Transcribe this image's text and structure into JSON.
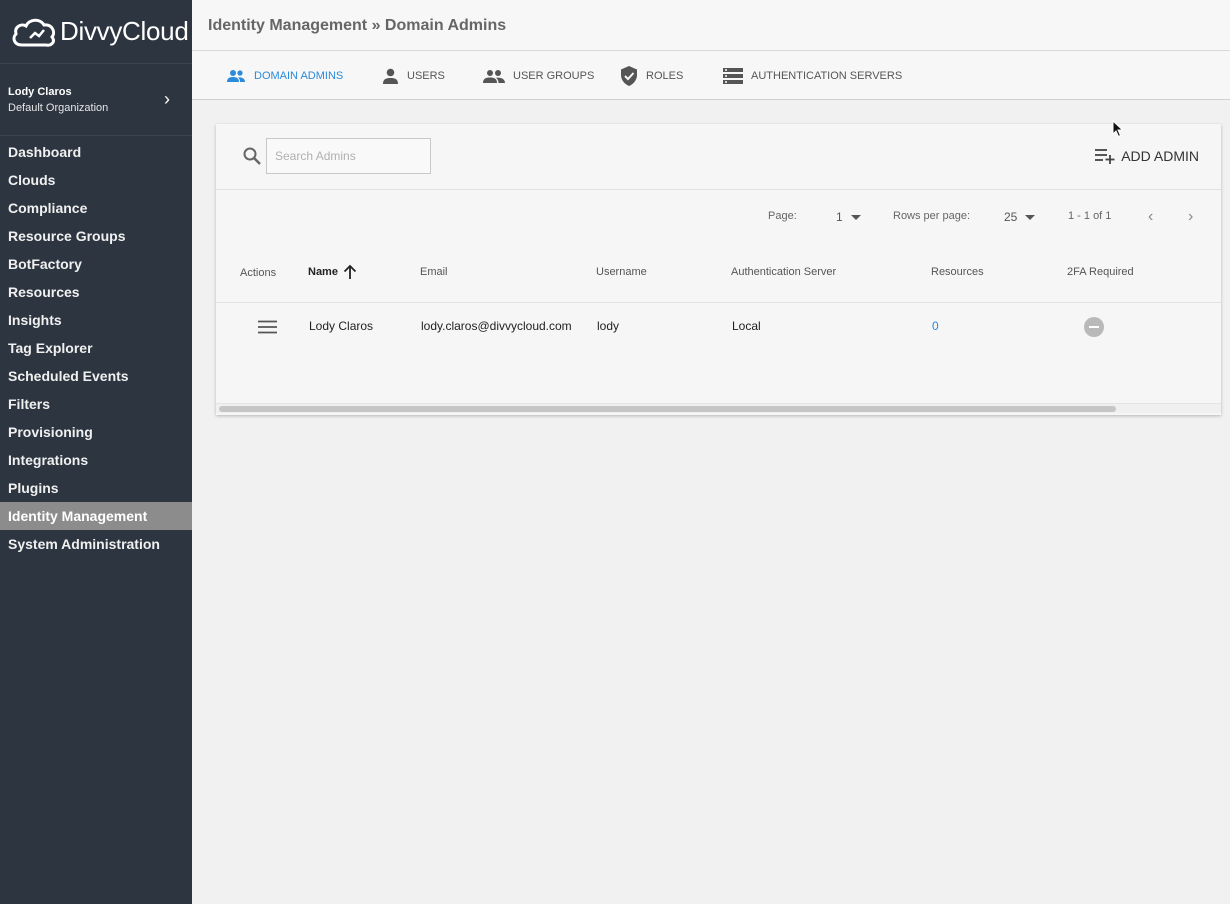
{
  "brand": {
    "name": "DivvyCloud"
  },
  "user": {
    "name": "Lody Claros",
    "org": "Default Organization"
  },
  "nav": {
    "items": [
      "Dashboard",
      "Clouds",
      "Compliance",
      "Resource Groups",
      "BotFactory",
      "Resources",
      "Insights",
      "Tag Explorer",
      "Scheduled Events",
      "Filters",
      "Provisioning",
      "Integrations",
      "Plugins",
      "Identity Management",
      "System Administration"
    ],
    "active": "Identity Management"
  },
  "header": {
    "breadcrumb": "Identity Management » Domain Admins"
  },
  "tabs": [
    {
      "label": "DOMAIN ADMINS",
      "icon": "people-icon",
      "active": true
    },
    {
      "label": "USERS",
      "icon": "person-icon",
      "active": false
    },
    {
      "label": "USER GROUPS",
      "icon": "group-icon",
      "active": false
    },
    {
      "label": "ROLES",
      "icon": "shield-icon",
      "active": false
    },
    {
      "label": "AUTHENTICATION SERVERS",
      "icon": "server-icon",
      "active": false
    }
  ],
  "toolbar": {
    "search_placeholder": "Search Admins",
    "add_label": "ADD ADMIN"
  },
  "pagination": {
    "page_label": "Page:",
    "page_value": "1",
    "rows_label": "Rows per page:",
    "rows_value": "25",
    "range": "1 - 1 of 1"
  },
  "table": {
    "columns": [
      "Actions",
      "Name",
      "Email",
      "Username",
      "Authentication Server",
      "Resources",
      "2FA Required"
    ],
    "sort": {
      "column": "Name",
      "direction": "ascending"
    },
    "rows": [
      {
        "name": "Lody Claros",
        "email": "lody.claros@divvycloud.com",
        "username": "lody",
        "auth_server": "Local",
        "resources": "0",
        "twofa_required": false
      }
    ]
  },
  "colors": {
    "sidebar": "#2d3541",
    "accent": "#2b8ad9",
    "active_nav": "#8c8c8c"
  }
}
